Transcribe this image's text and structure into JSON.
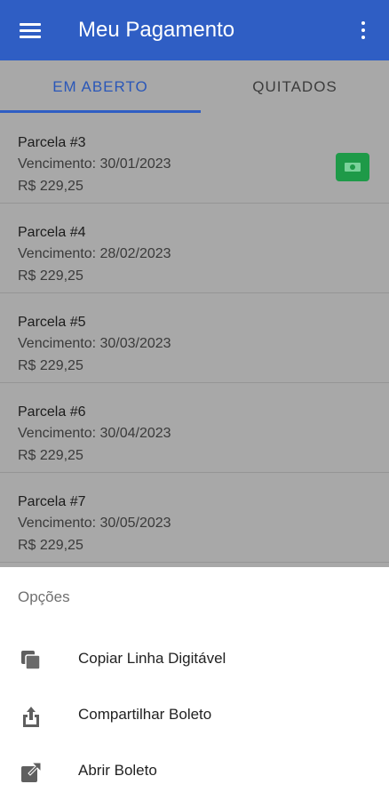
{
  "appbar": {
    "title": "Meu Pagamento",
    "menu_icon": "menu-icon",
    "more_icon": "more-vert-icon",
    "color": "#2f5ec4"
  },
  "tabs": [
    {
      "label": "EM ABERTO",
      "active": true
    },
    {
      "label": "QUITADOS",
      "active": false
    }
  ],
  "installments": [
    {
      "name": "Parcela #3",
      "due": "Vencimento: 30/01/2023",
      "amount": "R$ 229,25",
      "pay_icon": "payment-icon"
    },
    {
      "name": "Parcela #4",
      "due": "Vencimento: 28/02/2023",
      "amount": "R$ 229,25"
    },
    {
      "name": "Parcela #5",
      "due": "Vencimento: 30/03/2023",
      "amount": "R$ 229,25"
    },
    {
      "name": "Parcela #6",
      "due": "Vencimento: 30/04/2023",
      "amount": "R$ 229,25"
    },
    {
      "name": "Parcela #7",
      "due": "Vencimento: 30/05/2023",
      "amount": "R$ 229,25"
    }
  ],
  "sheet": {
    "title": "Opções",
    "options": [
      {
        "label": "Copiar Linha Digitável",
        "icon": "copy-icon"
      },
      {
        "label": "Compartilhar Boleto",
        "icon": "share-icon"
      },
      {
        "label": "Abrir Boleto",
        "icon": "open-external-icon"
      }
    ]
  }
}
